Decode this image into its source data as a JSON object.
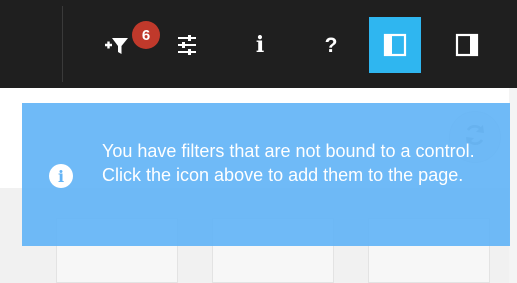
{
  "toolbar": {
    "filter_badge_count": "6",
    "info_glyph": "i",
    "help_glyph": "?",
    "buttons": [
      {
        "icon": "add-filter-icon"
      },
      {
        "icon": "sliders-icon"
      },
      {
        "icon": "info-icon"
      },
      {
        "icon": "help-icon"
      },
      {
        "icon": "left-panel-icon",
        "active": true
      },
      {
        "icon": "right-panel-icon"
      }
    ],
    "active_color": "#2fb6f0"
  },
  "notice": {
    "icon": "info-circle-icon",
    "icon_glyph": "i",
    "message": "You have filters that are not bound to a control. Click the icon above to add them to the page.",
    "background_color": "#64b5f6"
  },
  "refresh": {
    "icon": "refresh-icon"
  }
}
